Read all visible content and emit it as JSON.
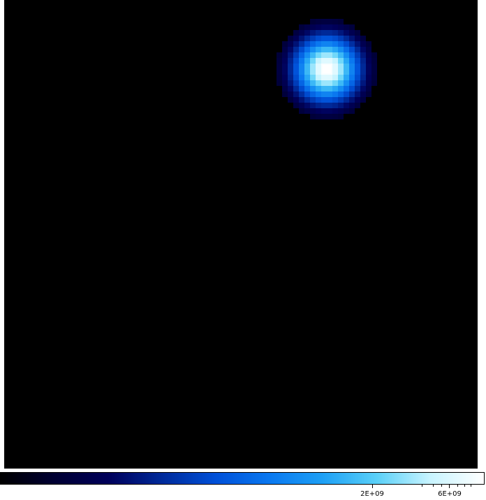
{
  "image": {
    "description_colormap": "black-blue-white",
    "background_color": "#000000",
    "source_peak_color": "#ffffff"
  },
  "colorbar": {
    "colors": [
      "#000000",
      "#000033",
      "#00005a",
      "#002a9a",
      "#0050d8",
      "#0a78f0",
      "#1ea0f5",
      "#5ad0f8",
      "#c8f4ff",
      "#ffffff"
    ],
    "ticks": [
      {
        "label": "2E+09"
      },
      {
        "label": "6E+09"
      }
    ]
  }
}
